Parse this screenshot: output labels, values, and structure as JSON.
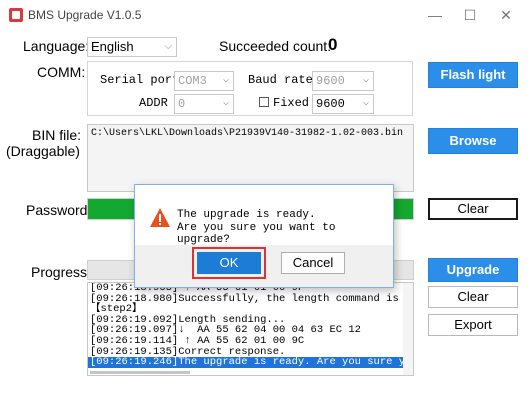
{
  "window": {
    "title": "BMS Upgrade V1.0.5",
    "min": "—",
    "max": "☐",
    "close": "✕"
  },
  "language": {
    "label": "Language:",
    "value": "English"
  },
  "succeeded": {
    "label": "Succeeded count:",
    "value": "0"
  },
  "comm": {
    "label": "COMM:",
    "serial_port_label": "Serial port",
    "serial_port_value": "COM3",
    "baud_rate_label": "Baud rate",
    "baud_rate_value": "9600",
    "addr_label": "ADDR",
    "addr_value": "0",
    "fixed_label": "Fixed",
    "fixed_value": "9600",
    "fixed_checked": false
  },
  "buttons": {
    "flash_light": "Flash light",
    "browse": "Browse",
    "clear_password": "Clear",
    "upgrade": "Upgrade",
    "clear_log": "Clear",
    "export": "Export"
  },
  "bin_file": {
    "label_line1": "BIN file:",
    "label_line2": "(Draggable)",
    "path": "C:\\Users\\LKL\\Downloads\\P21939V140-31982-1.02-003.bin"
  },
  "password": {
    "label": "Password:",
    "progress": 1.0
  },
  "progress": {
    "label": "Progress:",
    "value": 0
  },
  "log": [
    "[09:26:18.965] ↑ AA 55 61 01 00 9F",
    "[09:26:18.980]Successfully, the length command is be",
    "【step2】",
    "[09:26:19.092]Length sending...",
    "[09:26:19.097]↓  AA 55 62 04 00 04 63 EC 12",
    "[09:26:19.114] ↑ AA 55 62 01 00 9C",
    "[09:26:19.135]Correct response.",
    "[09:26:19.246]The upgrade is ready. Are you sure you"
  ],
  "dialog": {
    "line1": "The upgrade is ready.",
    "line2": "Are you sure you want to upgrade?",
    "ok": "OK",
    "cancel": "Cancel",
    "icon": "warning-icon"
  },
  "colors": {
    "accent": "#2b8ee8",
    "progress_green": "#14a830",
    "highlight": "#e03030"
  }
}
